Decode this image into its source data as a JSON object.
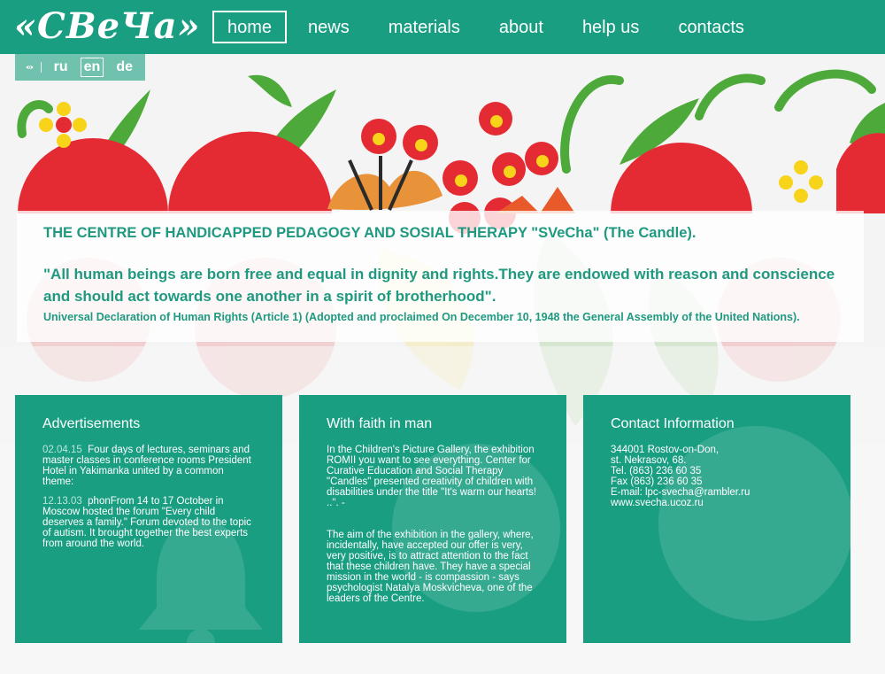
{
  "header": {
    "logo": "«СВеЧа»",
    "nav": [
      "home",
      "news",
      "materials",
      "about",
      "help us",
      "contacts"
    ],
    "active_nav": "home"
  },
  "languages": {
    "icon": "eye-icon",
    "items": [
      "ru",
      "en",
      "de"
    ],
    "active": "en"
  },
  "intro": {
    "title": "THE CENTRE OF HANDICAPPED PEDAGOGY AND SOSIAL THERAPY \"SVeCha\" (The Candle).",
    "quote": " \"All human beings are born free and equal in dignity and rights.They are endowed with reason and conscience and should act towards one another in a spirit of brotherhood\".",
    "source": "Universal Declaration of Human Rights (Article 1) (Adopted and proclaimed On December 10, 1948 the General Assembly of the United Nations)."
  },
  "cards": {
    "ads": {
      "title": "Advertisements",
      "items": [
        {
          "date": "02.04.15",
          "text": "Four days of lectures, seminars and master classes in conference rooms President Hotel in Yakimanka united by a common theme:"
        },
        {
          "date": "12.13.03",
          "text": "phonFrom 14 to 17 October in Moscow hosted the forum \"Every child deserves a family.\" Forum devoted to the topic of autism. It brought together the best experts from around the world."
        }
      ],
      "icon": "bell-icon"
    },
    "faith": {
      "title": "With faith in man",
      "paragraphs": [
        "In the Children's Picture Gallery, the exhibition ROMII you want to see everything. Center for Curative Education and Social Therapy \"Candles\" presented creativity of children with disabilities under the title \"It's warm our hearts! ..\". -",
        "The aim of the exhibition in the gallery, where, incidentally, have accepted our offer is very, very positive, is to attract attention to the fact that these children have. They have a special mission in the world - is compassion - says psychologist Natalya Moskvicheva, one of the leaders of the Centre."
      ],
      "icon": "heart-icon"
    },
    "contact": {
      "title": "Contact Information",
      "lines": [
        "344001 Rostov-on-Don,",
        "st. Nekrasov, 68.",
        "Tel. (863) 236 60 35",
        "Fax (863) 236 60 35",
        "E-mail: lpc-svecha@rambler.ru",
        "www.svecha.ucoz.ru"
      ],
      "icon": "phone-icon"
    }
  },
  "colors": {
    "brand": "#1a9e82",
    "accent_red": "#e42b34",
    "accent_yellow": "#f7d31a",
    "leaf_green": "#4daa3a"
  }
}
